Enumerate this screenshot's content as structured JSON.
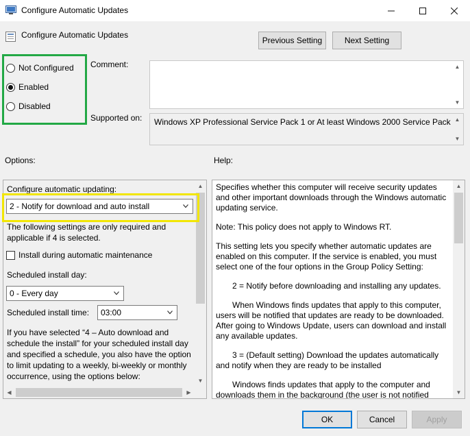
{
  "window": {
    "title": "Configure Automatic Updates",
    "controls": {
      "minimize": "—",
      "maximize": "☐",
      "close": "✕"
    }
  },
  "header": {
    "setting_name": "Configure Automatic Updates",
    "previous_button": "Previous Setting",
    "next_button": "Next Setting"
  },
  "state": {
    "options": [
      {
        "label": "Not Configured",
        "checked": false
      },
      {
        "label": "Enabled",
        "checked": true
      },
      {
        "label": "Disabled",
        "checked": false
      }
    ]
  },
  "comment": {
    "label": "Comment:",
    "value": ""
  },
  "supported": {
    "label": "Supported on:",
    "value": "Windows XP Professional Service Pack 1 or At least Windows 2000 Service Pack 3"
  },
  "options_section": {
    "label": "Options:",
    "configure_label": "Configure automatic updating:",
    "configure_value": "2 - Notify for download and auto install",
    "note": "The following settings are only required and applicable if 4 is selected.",
    "install_maintenance_label": "Install during automatic maintenance",
    "install_maintenance_checked": false,
    "install_day_label": "Scheduled install day:",
    "install_day_value": "0 - Every day",
    "install_time_label": "Scheduled install time:",
    "install_time_value": "03:00",
    "extra_text": "If you have selected “4 – Auto download and schedule the install” for your scheduled install day and specified a schedule, you also have the option to limit updating to a weekly, bi-weekly or monthly occurrence, using the options below:"
  },
  "help_section": {
    "label": "Help:",
    "paragraphs": [
      "Specifies whether this computer will receive security updates and other important downloads through the Windows automatic updating service.",
      "Note: This policy does not apply to Windows RT.",
      "This setting lets you specify whether automatic updates are enabled on this computer. If the service is enabled, you must select one of the four options in the Group Policy Setting:",
      "2 = Notify before downloading and installing any updates.",
      "When Windows finds updates that apply to this computer, users will be notified that updates are ready to be downloaded. After going to Windows Update, users can download and install any available updates.",
      "3 = (Default setting) Download the updates automatically and notify when they are ready to be installed",
      "Windows finds updates that apply to the computer and downloads them in the background (the user is not notified"
    ]
  },
  "footer": {
    "ok": "OK",
    "cancel": "Cancel",
    "apply": "Apply"
  },
  "colors": {
    "highlight_green": "#22a845",
    "highlight_yellow": "#f2e600",
    "accent": "#0078d7"
  }
}
